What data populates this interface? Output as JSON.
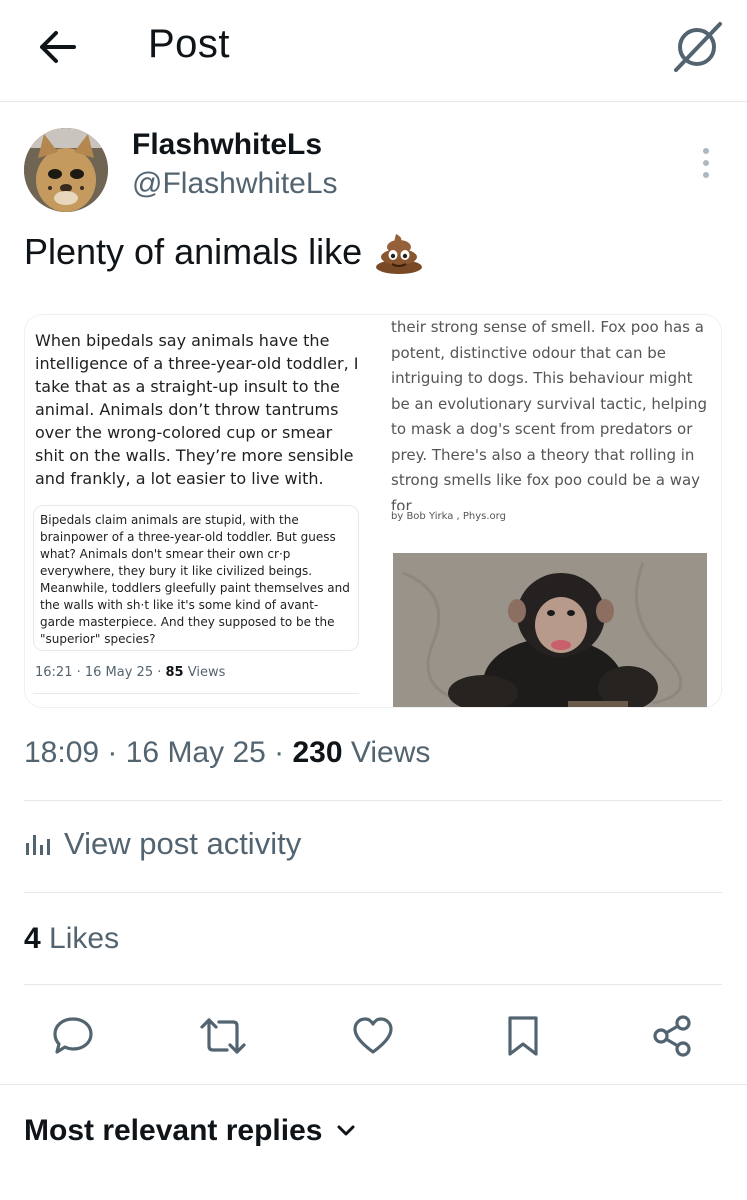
{
  "header": {
    "title": "Post",
    "back_icon": "arrow-left-icon",
    "grok_icon": "grok-icon"
  },
  "author": {
    "name": "FlashwhiteLs",
    "handle": "@FlashwhiteLs"
  },
  "post": {
    "text": "Plenty of animals like",
    "emoji": "pile-of-poo-icon",
    "media": {
      "left": {
        "main_text": "When bipedals say animals have the intelligence of a three-year-old toddler, I take that as a straight-up insult to the animal. Animals don’t throw tantrums over the wrong-colored cup or smear shit on the walls. They’re more sensible and frankly, a lot easier to live with.",
        "quote_text": "Bipedals claim animals are stupid, with the brainpower of a three-year-old toddler. But guess what? Animals don't smear their own cr·p everywhere, they bury it like civilized beings. Meanwhile, toddlers gleefully paint themselves and the walls with sh·t like it's some kind of avant-garde masterpiece. And they supposed to be the \"superior\" species?",
        "quote_time": "16:21 · 16 May 25 ·",
        "quote_views_count": "85",
        "quote_views_label": "Views"
      },
      "right": {
        "article_text": "their strong sense of smell. Fox poo has a potent, distinctive odour that can be intriguing to dogs. This behaviour might be an evolutionary survival tactic, helping to mask a dog's scent from predators or prey. There's also a theory that rolling in strong smells like fox poo could be a way for",
        "byline": "by Bob Yirka , Phys.org",
        "photo": "chimpanzee photo"
      }
    }
  },
  "meta": {
    "time": "18:09 · 16 May 25 ·",
    "views_count": "230",
    "views_label": "Views"
  },
  "activity": {
    "label": "View post activity",
    "icon": "bar-chart-icon"
  },
  "likes": {
    "count": "4",
    "label": "Likes"
  },
  "actions": [
    "reply-icon",
    "repost-icon",
    "like-icon",
    "bookmark-icon",
    "share-icon"
  ],
  "replies": {
    "label": "Most relevant replies"
  },
  "colors": {
    "text": "#0f1419",
    "secondary": "#536471",
    "divider": "#e6e8ea"
  }
}
